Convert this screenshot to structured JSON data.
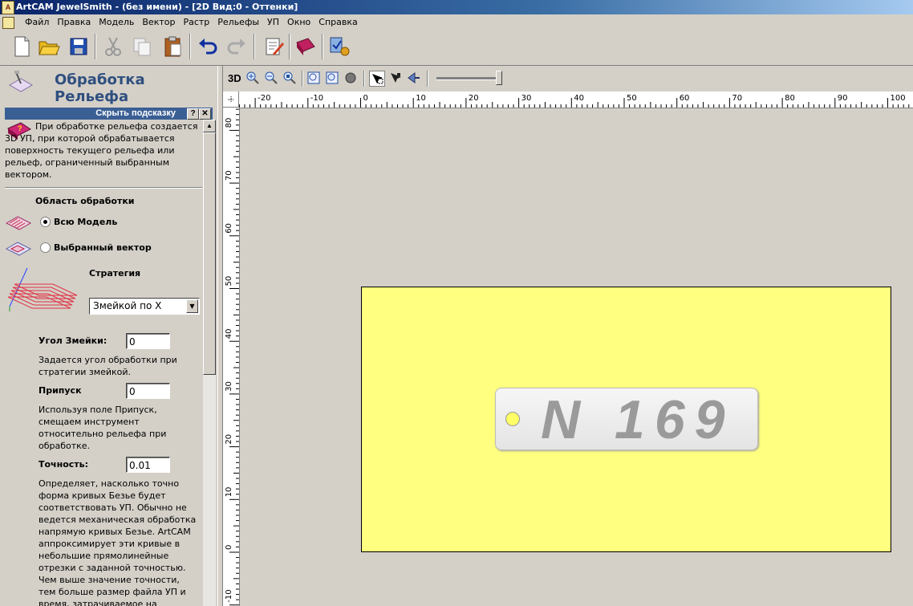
{
  "window": {
    "title": "ArtCAM JewelSmith - (без имени) - [2D Вид:0 - Оттенки]"
  },
  "menu": [
    "Файл",
    "Правка",
    "Модель",
    "Вектор",
    "Растр",
    "Рельефы",
    "УП",
    "Окно",
    "Справка"
  ],
  "toolbar": {
    "icons": [
      "new-file-icon",
      "open-folder-icon",
      "save-icon",
      "cut-icon",
      "copy-icon",
      "paste-icon",
      "undo-icon",
      "redo-icon",
      "notes-icon",
      "help-book-icon",
      "wizard-icon"
    ]
  },
  "panel": {
    "title": "Обработка Рельефа",
    "hint_bar": "Скрыть подсказку",
    "hint_help": "?",
    "hint_close": "✕",
    "hint_text": "При обработке рельефа создается 3D УП, при которой обрабатывается поверхность текущего рельефа или рельеф, ограниченный выбранным вектором.",
    "area_label": "Область обработки",
    "radio_all": "Всю Модель",
    "radio_vector": "Выбранный вектор",
    "strategy_label": "Стратегия",
    "strategy_value": "Змейкой по X",
    "angle_label": "Угол Змейки:",
    "angle_value": "0",
    "angle_desc": "Задается угол обработки при стратегии змейкой.",
    "allowance_label": "Припуск",
    "allowance_value": "0",
    "allowance_desc": "Используя поле Припуск, смещаем инструмент относительно рельефа при обработке.",
    "tolerance_label": "Точность:",
    "tolerance_value": "0.01",
    "tolerance_desc": "Определяет, насколько точно форма кривых Безье будет соответствовать УП. Обычно не ведется механическая обработка напрямую кривых Безье. ArtCAM аппроксимирует эти кривые в небольшие прямолинейные отрезки с заданной точностью. Чем выше значение точности, тем больше размер файла УП и время, затрачиваемое на"
  },
  "view_toolbar": {
    "mode_3d": "3D",
    "zoom_level_fraction": 0.95
  },
  "rulers": {
    "x_ticks": [
      "-20",
      "-10",
      "0",
      "10",
      "20",
      "30",
      "40",
      "50",
      "60",
      "70",
      "80",
      "90",
      "100"
    ],
    "y_ticks": [
      "80",
      "70",
      "60",
      "50",
      "40",
      "30",
      "20",
      "10",
      "0",
      "-10"
    ]
  },
  "canvas": {
    "plate_color": "#ffff80",
    "tag_text": "N 169",
    "background": "#d4d0c8"
  }
}
